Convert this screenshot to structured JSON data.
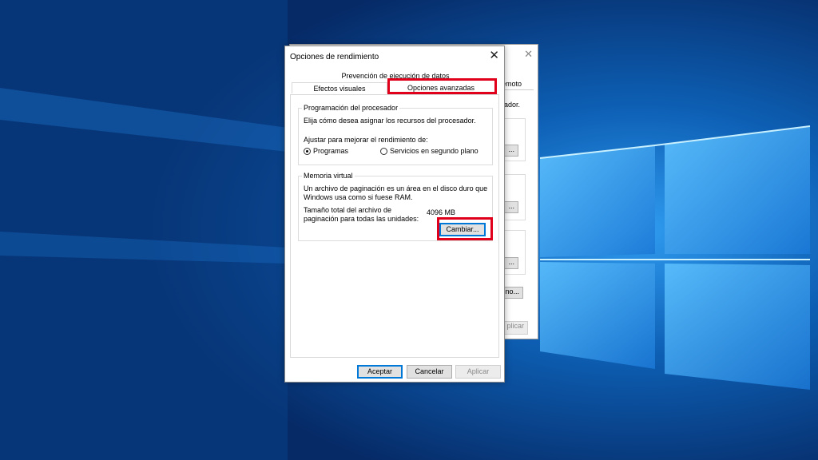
{
  "dialog": {
    "title": "Opciones de rendimiento",
    "tabs": [
      {
        "label": "Prevención de ejecución de datos"
      },
      {
        "label": "Efectos visuales"
      },
      {
        "label": "Opciones avanzadas"
      }
    ],
    "processor": {
      "group_label": "Programación del procesador",
      "description": "Elija cómo desea asignar los recursos del procesador.",
      "adjust_label": "Ajustar para mejorar el rendimiento de:",
      "option_programs": "Programas",
      "option_services": "Servicios en segundo plano",
      "selected": "Programas"
    },
    "virtual_memory": {
      "group_label": "Memoria virtual",
      "description_line1": "Un archivo de paginación es un área en el disco duro que",
      "description_line2": "Windows usa como si fuese RAM.",
      "total_label_line1": "Tamaño total del archivo de",
      "total_label_line2": "paginación para todas las unidades:",
      "total_value": "4096 MB",
      "change_button": "Cambiar..."
    },
    "buttons": {
      "accept": "Aceptar",
      "cancel": "Cancelar",
      "apply": "Aplicar"
    }
  },
  "background_window": {
    "tab_fragment": "emoto",
    "text_fragment": "rador.",
    "button_fragment_1": "...",
    "button_fragment_2": "...",
    "button_fragment_3": "...",
    "button_fragment_4": "no...",
    "apply_fragment": "plicar"
  },
  "colors": {
    "highlight": "#e0001b",
    "desktop": "#0a4c94",
    "default_button_border": "#0078d7"
  }
}
